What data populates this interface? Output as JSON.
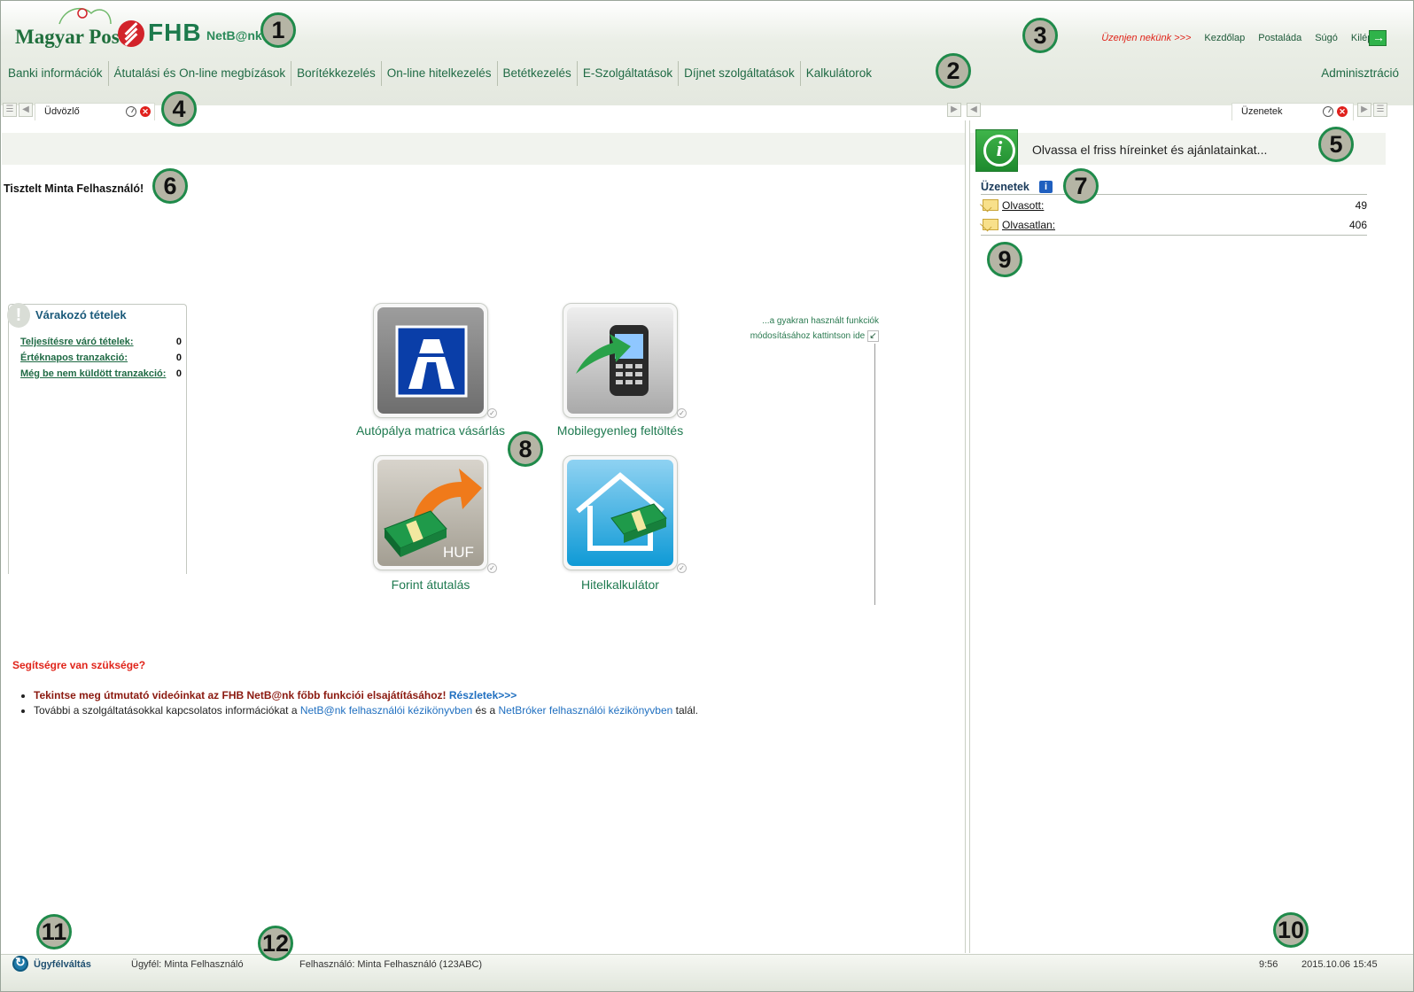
{
  "header": {
    "logo_posta": "Magyar Posta",
    "logo_fhb": "FHB",
    "logo_netbank": "NetB@nk",
    "top_links": {
      "contact": "Üzenjen nekünk >>>",
      "home": "Kezdőlap",
      "mailbox": "Postaláda",
      "help": "Súgó",
      "logout": "Kilépés"
    },
    "main_menu": [
      "Banki információk",
      "Átutalási és On-line megbízások",
      "Borítékkezelés",
      "On-line hitelkezelés",
      "Betétkezelés",
      "E-Szolgáltatások",
      "Díjnet szolgáltatások",
      "Kalkulátorok"
    ],
    "admin": "Adminisztráció"
  },
  "tabs": {
    "left": {
      "label": "Üdvözlő"
    },
    "right": {
      "label": "Üzenetek"
    }
  },
  "welcome": {
    "greeting": "Tisztelt Minta Felhasználó!",
    "waiting": {
      "title": "Várakozó tételek",
      "rows": [
        {
          "label": "Teljesítésre váró tételek:",
          "value": "0"
        },
        {
          "label": "Értéknapos tranzakció:",
          "value": "0"
        },
        {
          "label": "Még be nem küldött tranzakció:",
          "value": "0"
        }
      ]
    },
    "quick_hint_line1": "...a gyakran használt funkciók",
    "quick_hint_line2": "módosításához kattintson ide",
    "quick_tiles": [
      {
        "label": "Autópálya matrica vásárlás",
        "icon": "highway-sign-icon"
      },
      {
        "label": "Mobilegyenleg feltöltés",
        "icon": "mobile-phone-topup-icon"
      },
      {
        "label": "Forint átutalás",
        "icon": "huf-transfer-icon",
        "badge": "HUF"
      },
      {
        "label": "Hitelkalkulátor",
        "icon": "house-loan-icon"
      }
    ],
    "help": {
      "title": "Segítségre van szüksége?",
      "line1_text": "Tekintse meg útmutató videóinkat az FHB NetB@nk főbb funkciói elsajátításához!",
      "line1_link": "Részletek>>>",
      "line2_pre": "További a szolgáltatásokkal kapcsolatos információkat a",
      "line2_link1": "NetB@nk felhasználói kézikönyvben",
      "line2_mid": "és a",
      "line2_link2": "NetBróker felhasználói kézikönyvben",
      "line2_post": "talál."
    }
  },
  "messages": {
    "news": "Olvassa el friss híreinket és ajánlatainkat...",
    "title": "Üzenetek",
    "rows": [
      {
        "label": "Olvasott:",
        "value": "49"
      },
      {
        "label": "Olvasatlan:",
        "value": "406"
      }
    ]
  },
  "status": {
    "switch": "Ügyfélváltás",
    "client": "Ügyfél: Minta Felhasználó",
    "user": "Felhasználó: Minta Felhasználó (123ABC)",
    "timer": "9:56",
    "datetime": "2015.10.06 15:45"
  },
  "markers": [
    "1",
    "2",
    "3",
    "4",
    "5",
    "6",
    "7",
    "8",
    "9",
    "10",
    "11",
    "12"
  ],
  "colors": {
    "brand_green": "#1f7a50",
    "alert_red": "#e0241a",
    "link_blue": "#1f6fc0",
    "marker_ring": "#1f8a4a"
  }
}
